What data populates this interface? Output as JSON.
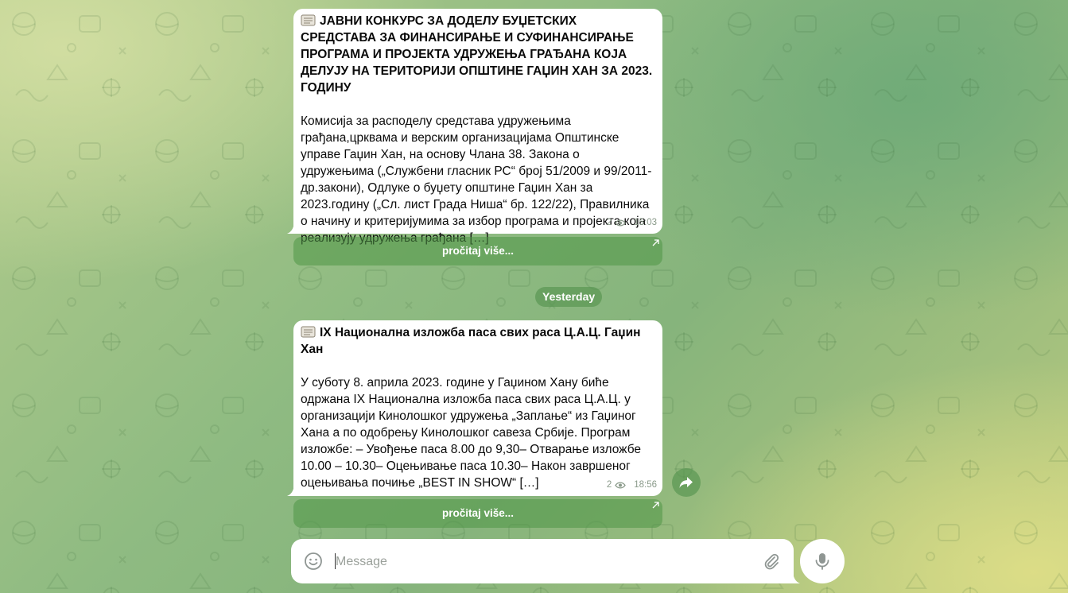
{
  "messages": [
    {
      "title": "ЈАВНИ КОНКУРС ЗА ДОДЕЛУ БУЏЕТСКИХ СРЕДСТАВА ЗА ФИНАНСИРАЊЕ И СУФИНАНСИРАЊЕ ПРОГРАМА И ПРОЈЕКТА УДРУЖЕЊА ГРАЂАНА КОЈА ДЕЛУЈУ НА ТЕРИТОРИЈИ ОПШТИНЕ ГАЏИН ХАН ЗА 2023. ГОДИНУ",
      "body": "Комисија за расподелу средстава  удружењима грађана,црквама и верским организацијама Општинске управе Гаџин Хан, на основу Члана 38. Закона о удружењима („Службени гласник РС“ број 51/2009 и 99/2011-др.закони), Одлуке о буџету општине Гаџин Хан за 2023.годину („Сл. лист Града Ниша“ бр. 122/22), Правилника о начину и критеријумима за избор програма и пројекта која реализују удружења грађана […]",
      "views": "2",
      "time": "15:03",
      "read_more": "pročitaj više..."
    },
    {
      "title": "IX Национална изложба паса свих раса Ц.А.Ц. Гаџин Хан",
      "body": "У суботу 8. априла 2023. године у Гаџином Хану биће одржана IX Национална изложба паса свих раса Ц.А.Ц. у организацији Кинолошког удружења „Заплање“ из Гаџиног Хана а по одобрењу Кинолошког савеза Србије. Програм изложбе: – Увођење паса 8.00 до 9,30– Отварање изложбе 10.00 – 10.30– Оцењивање паса 10.30– Након завршеног оцењивања почиње „BEST IN SHOW“ […]",
      "views": "2",
      "time": "18:56",
      "read_more": "pročitaj više..."
    }
  ],
  "date_separator": "Yesterday",
  "composer": {
    "placeholder": "Message",
    "value": ""
  },
  "icons": {
    "doc": "scroll-doc-icon",
    "views": "eye-icon",
    "share": "share-forward-icon",
    "emoji": "emoji-icon",
    "attach": "paperclip-icon",
    "mic": "microphone-icon",
    "link": "external-arrow-icon"
  },
  "colors": {
    "accent": "#4e9646",
    "bubble": "#ffffff",
    "meta": "#8a9a8a"
  }
}
